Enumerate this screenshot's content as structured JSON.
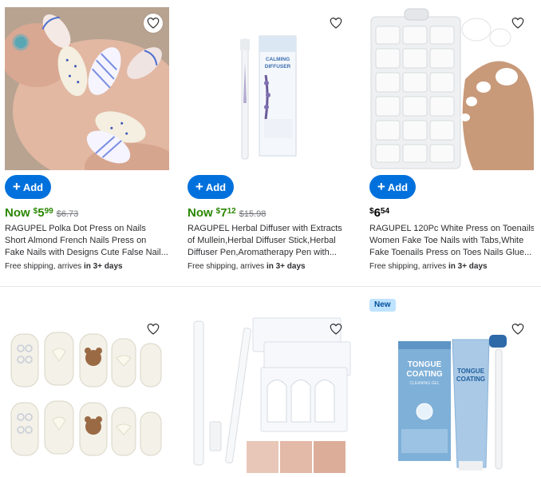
{
  "colors": {
    "accent": "#0071dc",
    "now_green": "#2a8703",
    "badge_bg": "#bfe3ff"
  },
  "products": [
    {
      "add_label": "Add",
      "now_label": "Now",
      "currency": "$",
      "price_dollars": "5",
      "price_cents": "99",
      "was_price": "$6.73",
      "title_lines": [
        "RAGUPEL Polka Dot Press on Nails",
        "Short Almond French Nails Press on",
        "Fake Nails with Designs Cute False Nail..."
      ],
      "ship_prefix": "Free shipping, arrives",
      "ship_bold": "in 3+ days",
      "favorite_icon": "heart-outline-icon"
    },
    {
      "add_label": "Add",
      "now_label": "Now",
      "currency": "$",
      "price_dollars": "7",
      "price_cents": "12",
      "was_price": "$15.98",
      "title_lines": [
        "RAGUPEL Herbal Diffuser with Extracts",
        "of Mullein,Herbal Diffuser Stick,Herbal",
        "Diffuser Pen,Aromatherapy Pen with..."
      ],
      "ship_prefix": "Free shipping, arrives",
      "ship_bold": "in 3+ days",
      "product_image_text": [
        "CALMING",
        "DIFFUSER"
      ],
      "favorite_icon": "heart-outline-icon"
    },
    {
      "add_label": "Add",
      "currency": "$",
      "price_dollars": "6",
      "price_cents": "54",
      "title_lines": [
        "RAGUPEL 120Pc White Press on Toenails",
        "Women Fake Toe Nails with Tabs,White",
        "Fake Toenails Press on Toes Nails Glue..."
      ],
      "ship_prefix": "Free shipping, arrives",
      "ship_bold": "in 3+ days",
      "favorite_icon": "heart-outline-icon"
    },
    {
      "favorite_icon": "heart-outline-icon"
    },
    {
      "favorite_icon": "heart-outline-icon"
    },
    {
      "badge": "New",
      "product_image_text": [
        "TONGUE",
        "COATING",
        "CLEANING GEL"
      ],
      "favorite_icon": "heart-outline-icon"
    }
  ]
}
